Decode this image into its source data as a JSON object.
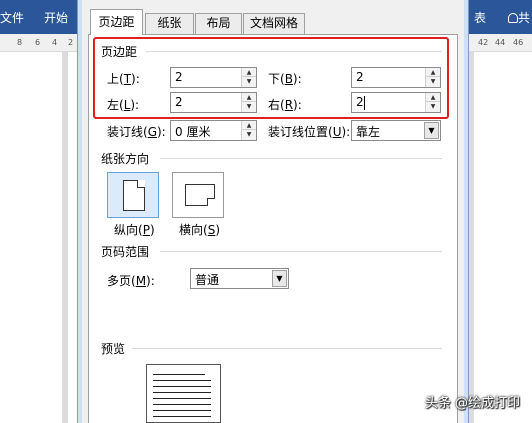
{
  "ribbon": {
    "file_label": "文件",
    "home_label": "开始",
    "right_partial": "表",
    "share_partial": "共"
  },
  "ruler": {
    "left_numbers": [
      "8",
      "6",
      "4",
      "2"
    ],
    "right_numbers": [
      "42",
      "44",
      "46"
    ]
  },
  "dialog": {
    "tabs": [
      "页边距",
      "纸张",
      "布局",
      "文档网格"
    ],
    "active_tab": "页边距",
    "margins": {
      "title": "页边距",
      "top_label": "上(",
      "top_key": "T",
      "top_value": "2",
      "bottom_label": "下(",
      "bottom_key": "B",
      "bottom_value": "2",
      "left_label": "左(",
      "left_key": "L",
      "left_value": "2",
      "right_label": "右(",
      "right_key": "R",
      "right_value": "2",
      "gutter_label": "装订线(",
      "gutter_key": "G",
      "gutter_value": "0 厘米",
      "gutter_pos_label": "装订线位置(",
      "gutter_pos_key": "U",
      "gutter_pos_value": "靠左",
      "close_paren": "):"
    },
    "orientation": {
      "title": "纸张方向",
      "portrait_label": "纵向(",
      "portrait_key": "P",
      "landscape_label": "横向(",
      "landscape_key": "S",
      "close_paren": ")",
      "selected": "portrait"
    },
    "pages": {
      "title": "页码范围",
      "multiple_label": "多页(",
      "multiple_key": "M",
      "multiple_value": "普通",
      "close_paren": "):"
    },
    "preview": {
      "title": "预览"
    }
  },
  "watermark": "头条 @绘成打印",
  "colors": {
    "ribbon": "#2b579a",
    "highlight": "#e02020",
    "selected_orientation": "#dcebfb"
  }
}
